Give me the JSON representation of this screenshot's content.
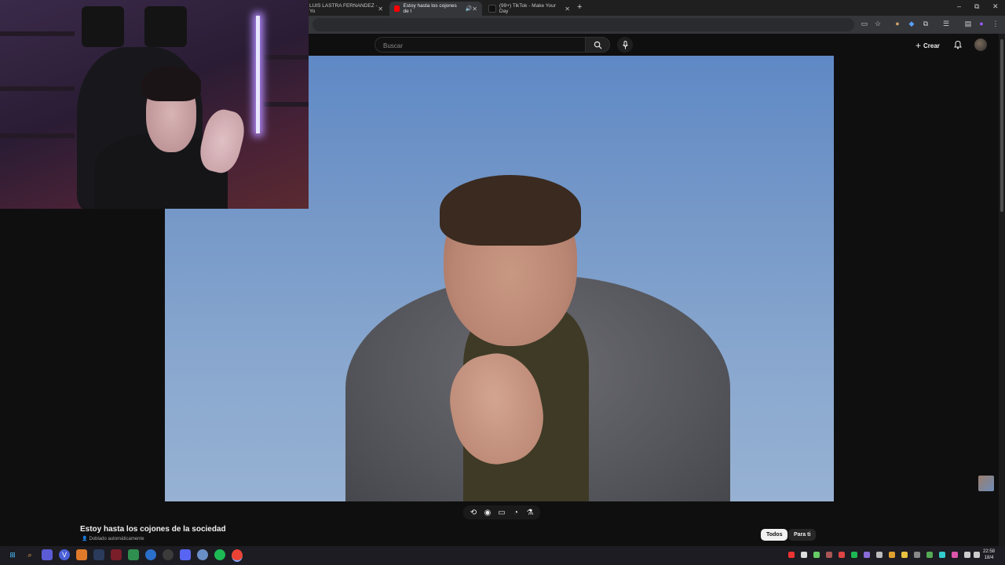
{
  "browser": {
    "tabs": [
      {
        "label": "LUIS LASTRA FERNANDEZ - Yo",
        "active": false
      },
      {
        "label": "Estoy hasta los cojones de l",
        "active": true
      },
      {
        "label": "(99+) TikTok - Make Your Day",
        "active": false
      }
    ],
    "new_tab": "+",
    "window_controls": {
      "minimize": "–",
      "restore": "⧉",
      "close": "✕"
    }
  },
  "header": {
    "search_placeholder": "Buscar",
    "create_label": "Crear"
  },
  "video": {
    "title": "Estoy hasta los cojones de la sociedad",
    "dubbing_label": "Doblado automáticamente"
  },
  "chips": [
    "Todos",
    "Para ti"
  ],
  "taskbar": {
    "time": "22:58",
    "date": "18/4"
  },
  "colors": {
    "background": "#0f0f0f",
    "video_sky_top": "#5f89c5",
    "video_sky_bottom": "#96b1d2",
    "chip_active": "#f1f1f1"
  }
}
